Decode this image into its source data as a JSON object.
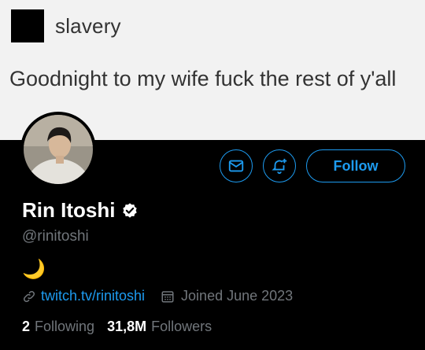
{
  "tweet": {
    "username": "slavery",
    "text": "Goodnight to my wife fuck the rest of y'all"
  },
  "profile": {
    "display_name": "Rin Itoshi",
    "handle": "@rinitoshi",
    "bio": "🌙",
    "website": "twitch.tv/rinitoshi",
    "joined": "Joined June 2023",
    "following_count": "2",
    "following_label": "Following",
    "followers_count": "31,8M",
    "followers_label": "Followers"
  },
  "buttons": {
    "follow": "Follow"
  },
  "icons": {
    "message": "mail-icon",
    "notify": "bell-plus-icon",
    "verified": "verified-badge-icon",
    "link": "link-icon",
    "calendar": "calendar-icon"
  },
  "colors": {
    "accent": "#1d9bf0",
    "muted": "#71767b"
  }
}
